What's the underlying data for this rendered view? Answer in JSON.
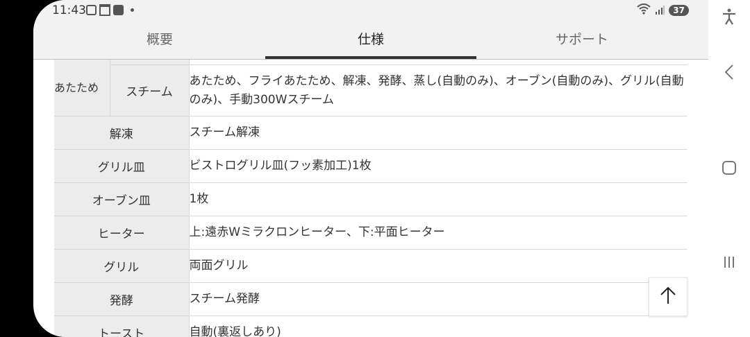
{
  "status_bar": {
    "time": "11:43",
    "battery": "37",
    "icons": [
      "scan-icon",
      "calendar-icon",
      "clipboard-icon",
      "dot-icon",
      "wifi-icon",
      "signal-icon",
      "battery-icon"
    ]
  },
  "tabs": [
    {
      "label": "概要",
      "active": false
    },
    {
      "label": "仕様",
      "active": true
    },
    {
      "label": "サポート",
      "active": false
    }
  ],
  "spec": {
    "group_label": "あたため",
    "steam": {
      "label": "スチーム",
      "value": "あたため、フライあたため、解凍、発酵、蒸し(自動のみ)、オーブン(自動のみ)、グリル(自動のみ)、手動300Wスチーム"
    },
    "rows": [
      {
        "label": "解凍",
        "value": "スチーム解凍"
      },
      {
        "label": "グリル皿",
        "value": "ビストログリル皿(フッ素加工)1枚"
      },
      {
        "label": "オーブン皿",
        "value": "1枚"
      },
      {
        "label": "ヒーター",
        "value": "上:遠赤Wミラクロンヒーター、下:平面ヒーター"
      },
      {
        "label": "グリル",
        "value": "両面グリル"
      },
      {
        "label": "発酵",
        "value": "スチーム発酵"
      },
      {
        "label": "トースト",
        "value": "自動(裏返しあり)"
      }
    ]
  },
  "colors": {
    "accent": "#333333",
    "label_bg": "#ececec",
    "tab_bg": "#f2f2f2",
    "border": "#d8d8d8"
  }
}
